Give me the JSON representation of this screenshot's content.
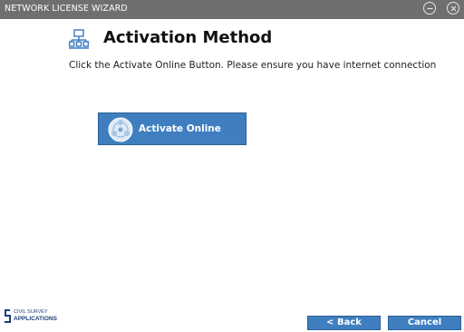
{
  "window": {
    "title": "NETWORK LICENSE WIZARD"
  },
  "header": {
    "title": "Activation Method",
    "icon": "network-icon"
  },
  "instruction": "Click the Activate Online Button. Please ensure you have internet connection",
  "activate_button": {
    "label": "Activate Online",
    "icon": "globe-icon"
  },
  "logo": {
    "line1": "CIVIL SURVEY",
    "line2": "APPLICATIONS"
  },
  "footer": {
    "back_label": "< Back",
    "cancel_label": "Cancel"
  },
  "colors": {
    "titlebar": "#6f6f6f",
    "button": "#3f7fc0",
    "icon_blue": "#3a78c2",
    "brand": "#1d3f7a"
  }
}
